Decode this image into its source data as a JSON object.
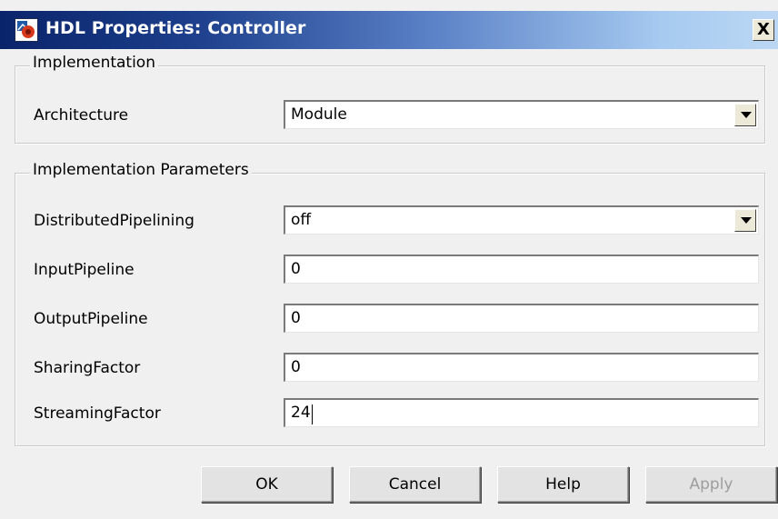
{
  "window": {
    "title": "HDL Properties: Controller",
    "close_label": "X"
  },
  "implementation": {
    "group_label": "Implementation",
    "architecture": {
      "label": "Architecture",
      "value": "Module"
    }
  },
  "implementation_parameters": {
    "group_label": "Implementation Parameters",
    "distributed_pipelining": {
      "label": "DistributedPipelining",
      "value": "off"
    },
    "input_pipeline": {
      "label": "InputPipeline",
      "value": "0"
    },
    "output_pipeline": {
      "label": "OutputPipeline",
      "value": "0"
    },
    "sharing_factor": {
      "label": "SharingFactor",
      "value": "0"
    },
    "streaming_factor": {
      "label": "StreamingFactor",
      "value": "24"
    }
  },
  "buttons": {
    "ok": "OK",
    "cancel": "Cancel",
    "help": "Help",
    "apply": "Apply"
  },
  "icons": {
    "app_icon": "simulink-block-icon",
    "dropdown": "chevron-down-icon",
    "close": "close-icon"
  },
  "colors": {
    "titlebar_start": "#0a246a",
    "titlebar_end": "#bcd7f4",
    "dialog_background": "#f0f0f0",
    "disabled_text": "#9d9d9d"
  }
}
